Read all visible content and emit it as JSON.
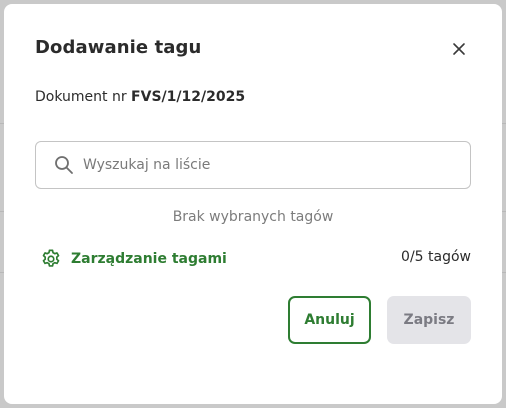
{
  "dialog": {
    "title": "Dodawanie tagu",
    "document_prefix": "Dokument nr ",
    "document_number": "FVS/1/12/2025",
    "search": {
      "placeholder": "Wyszukaj na liście",
      "value": ""
    },
    "empty_message": "Brak wybranych tagów",
    "manage_tags_label": "Zarządzanie tagami",
    "tag_count": "0/5 tagów",
    "cancel_label": "Anuluj",
    "save_label": "Zapisz"
  },
  "colors": {
    "accent": "#2e7d32",
    "text": "#2b2b2b",
    "muted": "#7c7c7c",
    "disabled_bg": "#e4e4e8",
    "disabled_text": "#7b7b83"
  },
  "icons": {
    "close": "close-icon",
    "search": "search-icon",
    "manage": "gear-icon"
  }
}
